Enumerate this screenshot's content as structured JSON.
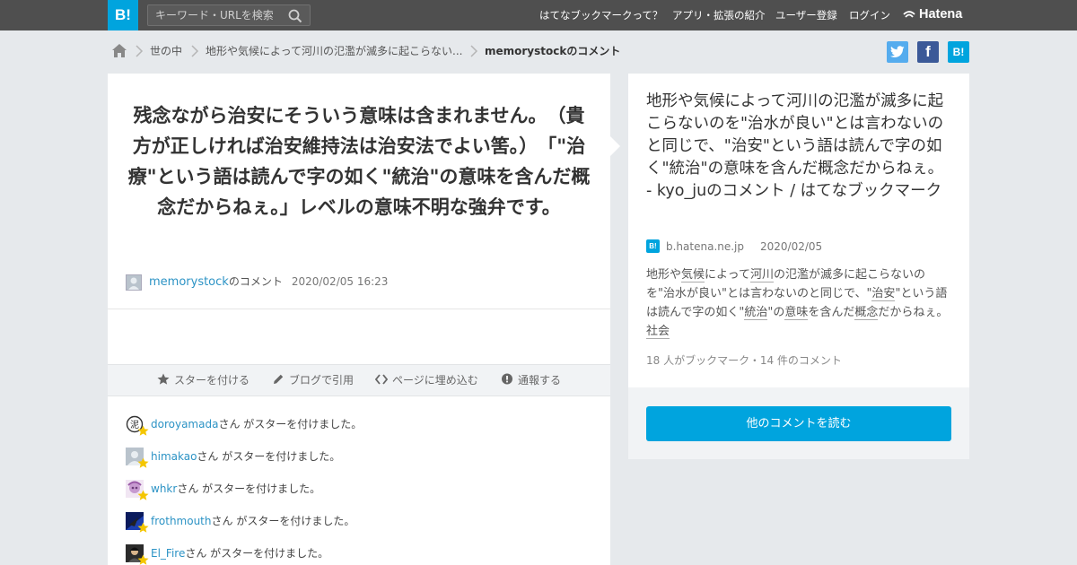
{
  "header": {
    "logo": "B!",
    "search_placeholder": "キーワード・URLを検索",
    "nav": [
      "はてなブックマークって？",
      "アプリ・拡張の紹介",
      "ユーザー登録",
      "ログイン"
    ],
    "brand": "Hatena"
  },
  "breadcrumb": [
    "世の中",
    "地形や気候によって河川の氾濫が滅多に起こらない...",
    "memorystockのコメント"
  ],
  "share": {
    "facebook": "f",
    "hatena": "B!"
  },
  "comment": {
    "text": "残念ながら治安にそういう意味は含まれません。　（貴方が正しければ治安維持法は治安法でよい筈。）　「\"治療\"という語は読んで字の如く\"統治\"の意味を含んだ概念だからねぇ。」レベルの意味不明な強弁です。",
    "user": "memorystock",
    "user_suffix": "のコメント",
    "date": "2020/02/05 16:23"
  },
  "actions": [
    "スターを付ける",
    "ブログで引用",
    "ページに埋め込む",
    "通報する"
  ],
  "stars": {
    "suffix": "さん がスターを付けました。",
    "users": [
      "doroyamada",
      "himakao",
      "whkr",
      "frothmouth",
      "El_Fire"
    ]
  },
  "entry": {
    "title": "地形や気候によって河川の氾濫が滅多に起こらないのを\"治水が良い\"とは言わないのと同じで、\"治安\"という語は読んで字の如く\"統治\"の意味を含んだ概念だからねぇ。 - kyo_juのコメント / はてなブックマーク",
    "source_icon": "B!",
    "domain": "b.hatena.ne.jp",
    "date": "2020/02/05",
    "desc": {
      "p1": "地形や",
      "k1": "気候",
      "p2": "によって",
      "k2": "河川",
      "p3": "の氾濫が滅多に起こらないのを\"治水が良い\"とは言わないのと同じで、\"",
      "k3": "治安",
      "p4": "\"という語は読んで字の如く\"",
      "k4": "統治",
      "p5": "\"の",
      "k5": "意味",
      "p6": "を含んだ",
      "k6": "概念",
      "p7": "だからねぇ。",
      "tag": "社会"
    },
    "stats": "18 人がブックマーク・14 件のコメント",
    "read_more": "他のコメントを読む"
  },
  "colors": {
    "accent": "#00a4de",
    "header_bg": "#4f4f4f",
    "link": "#2c93c5",
    "star": "#f4c600"
  }
}
